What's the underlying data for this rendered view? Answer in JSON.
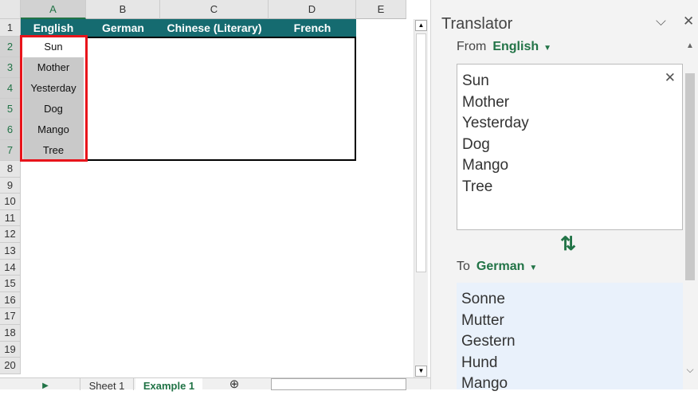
{
  "sheet": {
    "columns": [
      "A",
      "B",
      "C",
      "D",
      "E"
    ],
    "rows": [
      "1",
      "2",
      "3",
      "4",
      "5",
      "6",
      "7",
      "8",
      "9",
      "10",
      "11",
      "12",
      "13",
      "14",
      "15",
      "16",
      "17",
      "18",
      "19",
      "20"
    ],
    "headers": [
      "English",
      "German",
      "Chinese (Literary)",
      "French"
    ],
    "english": [
      "Sun",
      "Mother",
      "Yesterday",
      "Dog",
      "Mango",
      "Tree"
    ],
    "tabs": [
      "Sheet 1",
      "Example 1"
    ]
  },
  "pane": {
    "title": "Translator",
    "from_label": "From",
    "from_lang": "English",
    "to_label": "To",
    "to_lang": "German",
    "source": [
      "Sun",
      "Mother",
      "Yesterday",
      "Dog",
      "Mango",
      "Tree"
    ],
    "result": [
      "Sonne",
      "Mutter",
      "Gestern",
      "Hund",
      "Mango"
    ],
    "swap_icon": "⇅"
  }
}
